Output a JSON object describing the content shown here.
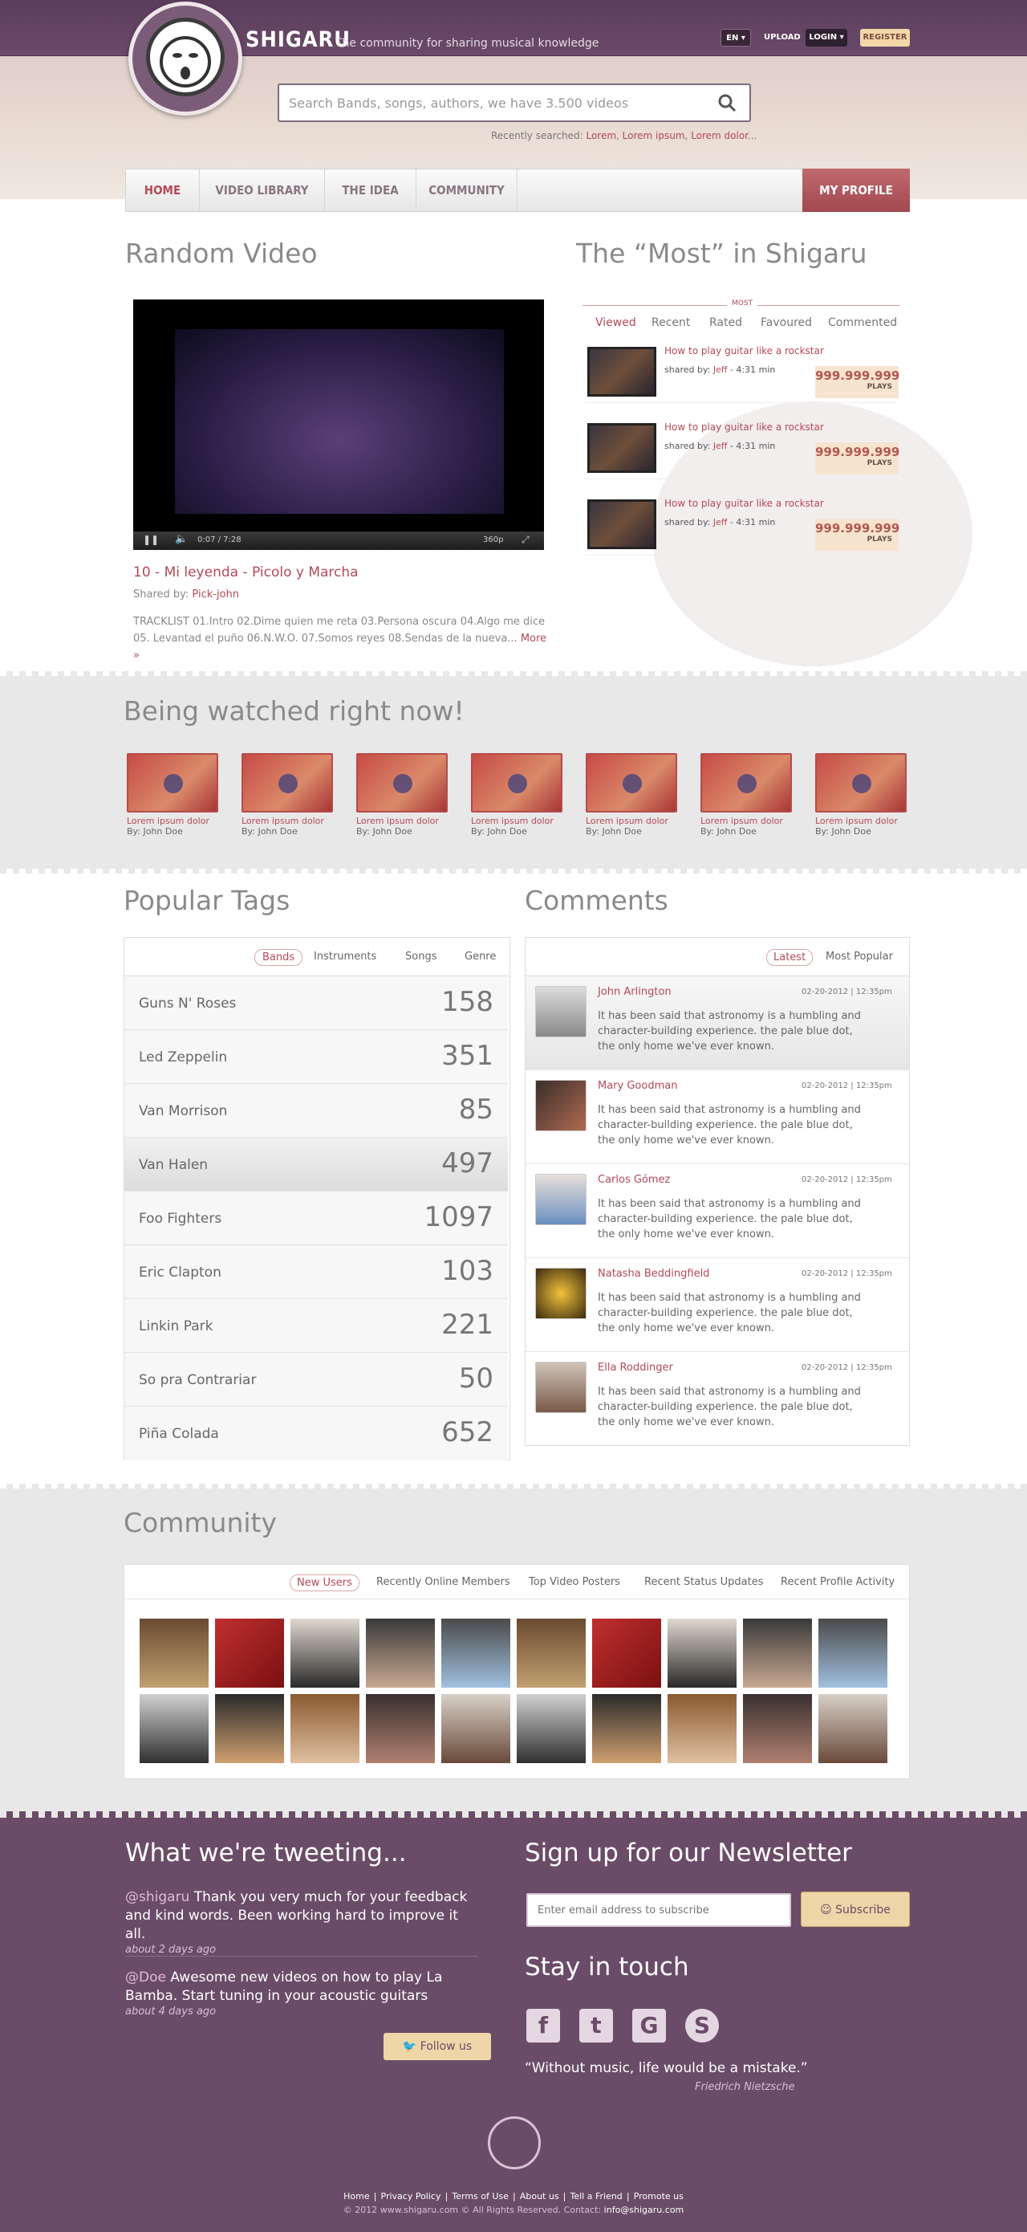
{
  "header": {
    "brand": "SHIGARU",
    "tagline": "The community for sharing musical knowledge",
    "lang": "EN",
    "upload": "UPLOAD",
    "login": "LOGIN",
    "register": "REGISTER",
    "search_placeholder": "Search Bands, songs, authors, we have 3.500 videos",
    "recent_label": "Recently searched:",
    "recent": [
      "Lorem",
      "Lorem ipsum",
      "Lorem dolor"
    ],
    "recent_ellipsis": "..."
  },
  "nav": {
    "items": [
      "HOME",
      "VIDEO LIBRARY",
      "THE IDEA",
      "COMMUNITY"
    ],
    "my_profile": "MY PROFILE"
  },
  "random_video": {
    "title": "Random Video",
    "time": "0:07 / 7:28",
    "quality": "360p",
    "video_title": "10 - Mi leyenda - Picolo y Marcha",
    "shared_label": "Shared by:",
    "shared_by": "Pick-john",
    "description": "TRACKLIST 01.Intro 02.Dime quien me reta 03.Persona oscura 04.Algo me dice 05. Levantad el puño 06.N.W.O. 07.Somos reyes 08.Sendas de la nueva...",
    "more": "More »"
  },
  "most": {
    "title": "The “Most” in Shigaru",
    "label": "MOST",
    "tabs": [
      "Viewed",
      "Recent",
      "Rated",
      "Favoured",
      "Commented"
    ],
    "items": [
      {
        "title": "How to play guitar like a rockstar",
        "shared": "shared by:",
        "user": "Jeff",
        "duration": "- 4:31 min",
        "plays": "999.999.999",
        "plays_label": "PLAYS"
      },
      {
        "title": "How to play guitar like a rockstar",
        "shared": "shared by:",
        "user": "Jeff",
        "duration": "- 4:31 min",
        "plays": "999.999.999",
        "plays_label": "PLAYS"
      },
      {
        "title": "How to play guitar like a rockstar",
        "shared": "shared by:",
        "user": "Jeff",
        "duration": "- 4:31 min",
        "plays": "999.999.999",
        "plays_label": "PLAYS"
      }
    ]
  },
  "watching": {
    "title": "Being watched right now!",
    "items": [
      {
        "title": "Lorem ipsum dolor",
        "by": "By: John Doe"
      },
      {
        "title": "Lorem ipsum dolor",
        "by": "By: John Doe"
      },
      {
        "title": "Lorem ipsum dolor",
        "by": "By: John Doe"
      },
      {
        "title": "Lorem ipsum dolor",
        "by": "By: John Doe"
      },
      {
        "title": "Lorem ipsum dolor",
        "by": "By: John Doe"
      },
      {
        "title": "Lorem ipsum dolor",
        "by": "By: John Doe"
      },
      {
        "title": "Lorem ipsum dolor",
        "by": "By: John Doe"
      }
    ]
  },
  "tags": {
    "title": "Popular Tags",
    "tabs": [
      "Bands",
      "Instruments",
      "Songs",
      "Genre"
    ],
    "rows": [
      {
        "name": "Guns N' Roses",
        "count": "158"
      },
      {
        "name": "Led Zeppelin",
        "count": "351"
      },
      {
        "name": "Van Morrison",
        "count": "85"
      },
      {
        "name": "Van Halen",
        "count": "497"
      },
      {
        "name": "Foo Fighters",
        "count": "1097"
      },
      {
        "name": "Eric Clapton",
        "count": "103"
      },
      {
        "name": "Linkin Park",
        "count": "221"
      },
      {
        "name": "So pra Contrariar",
        "count": "50"
      },
      {
        "name": "Piña Colada",
        "count": "652"
      }
    ]
  },
  "comments": {
    "title": "Comments",
    "tabs": [
      "Latest",
      "Most Popular"
    ],
    "items": [
      {
        "name": "John Arlington",
        "date": "02-20-2012",
        "time": "12:35pm",
        "text": "It has been said that astronomy is a humbling and character-building experience. the pale blue dot, the only home we've ever known."
      },
      {
        "name": "Mary Goodman",
        "date": "02-20-2012",
        "time": "12:35pm",
        "text": "It has been said that astronomy is a humbling and character-building experience. the pale blue dot, the only home we've ever known."
      },
      {
        "name": "Carlos Gómez",
        "date": "02-20-2012",
        "time": "12:35pm",
        "text": "It has been said that astronomy is a humbling and character-building experience. the pale blue dot, the only home we've ever known."
      },
      {
        "name": "Natasha Beddingfield",
        "date": "02-20-2012",
        "time": "12:35pm",
        "text": "It has been said that astronomy is a humbling and character-building experience. the pale blue dot, the only home we've ever known."
      },
      {
        "name": "Ella Roddinger",
        "date": "02-20-2012",
        "time": "12:35pm",
        "text": "It has been said that astronomy is a humbling and character-building experience. the pale blue dot, the only home we've ever known."
      }
    ]
  },
  "community": {
    "title": "Community",
    "tabs": [
      "New Users",
      "Recently Online Members",
      "Top Video Posters",
      "Recent Status Updates",
      "Recent Profile Activity"
    ]
  },
  "footer": {
    "tweets_title": "What we're tweeting...",
    "tweets": [
      {
        "handle": "@shigaru",
        "text": "Thank you very much for your feedback and kind words. Been working hard to improve it all.",
        "time": "about 2 days ago"
      },
      {
        "handle": "@Doe",
        "text": "Awesome new videos on how to play La Bamba. Start tuning in your acoustic guitars",
        "time": "about 4 days ago"
      }
    ],
    "follow": "Follow us",
    "newsletter_title": "Sign up for our Newsletter",
    "email_placeholder": "Enter email address to subscribe",
    "subscribe": "Subscribe",
    "stay_title": "Stay in touch",
    "quote": "“Without music, life would be a mistake.”",
    "quote_author": "Friedrich Nietzsche",
    "links": [
      "Home",
      "Privacy Policy",
      "Terms of Use",
      "About us",
      "Tell a Friend",
      "Promote us"
    ],
    "copyright": "© 2012 www.shigaru.com © All Rights Reserved. Contact:",
    "contact": "info@shigaru.com"
  }
}
